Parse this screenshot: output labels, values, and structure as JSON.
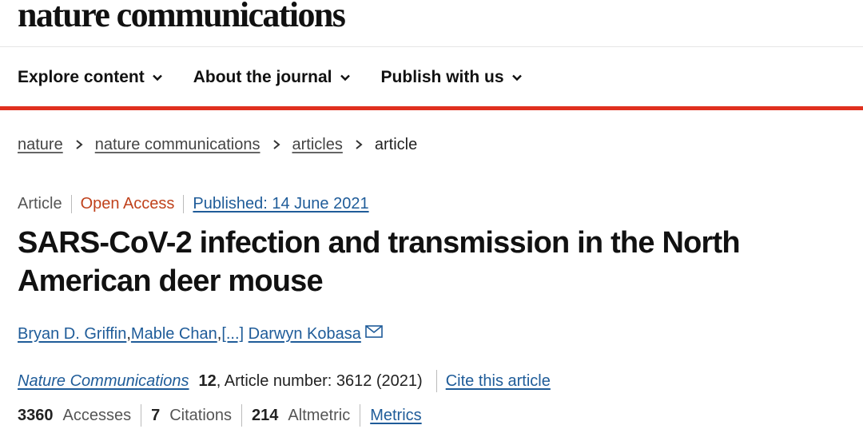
{
  "site": {
    "title": "nature communications"
  },
  "nav": {
    "items": [
      {
        "label": "Explore content"
      },
      {
        "label": "About the journal"
      },
      {
        "label": "Publish with us"
      }
    ]
  },
  "breadcrumb": {
    "items": [
      "nature",
      "nature communications",
      "articles"
    ],
    "current": "article"
  },
  "article": {
    "type": "Article",
    "access": "Open Access",
    "published": "Published: 14 June 2021",
    "title": "SARS-CoV-2 infection and transmission in the North American deer mouse",
    "authors": {
      "first": "Bryan D. Griffin",
      "second": "Mable Chan",
      "more": "[...]",
      "last": "Darwyn Kobasa",
      "sep": ", "
    },
    "journal": "Nature Communications",
    "volume": "12",
    "article_number": ", Article number: 3612 (2021)",
    "cite_label": "Cite this article"
  },
  "metrics": {
    "accesses_value": "3360",
    "accesses_label": "Accesses",
    "citations_value": "7",
    "citations_label": "Citations",
    "altmetric_value": "214",
    "altmetric_label": "Altmetric",
    "metrics_link": "Metrics"
  },
  "colors": {
    "accent_red": "#e0301e",
    "link_blue": "#1f5c99",
    "open_access": "#c0421c"
  },
  "icons": {
    "nav_chevron": "chevron-down-icon",
    "crumb_separator": "chevron-right-icon",
    "corresponding_author": "envelope-icon"
  }
}
